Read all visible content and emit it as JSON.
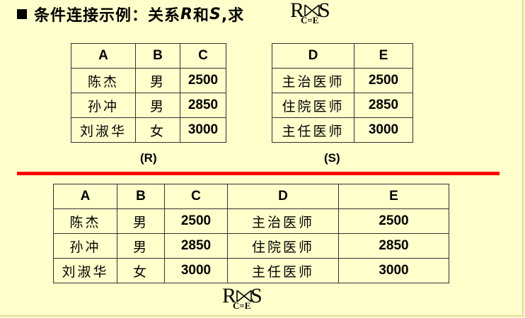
{
  "title": {
    "prefix": "条件连接示例：关系",
    "rel_r": "R",
    "middle": "和",
    "rel_s": "S",
    "suffix": ",求"
  },
  "join_symbol": {
    "left": "R",
    "right": "S",
    "condition": "C=E"
  },
  "table_r": {
    "caption": "(R)",
    "headers": [
      "A",
      "B",
      "C"
    ],
    "rows": [
      [
        "陈杰",
        "男",
        "2500"
      ],
      [
        "孙冲",
        "男",
        "2850"
      ],
      [
        "刘淑华",
        "女",
        "3000"
      ]
    ]
  },
  "table_s": {
    "caption": "(S)",
    "headers": [
      "D",
      "E"
    ],
    "rows": [
      [
        "主治医师",
        "2500"
      ],
      [
        "住院医师",
        "2850"
      ],
      [
        "主任医师",
        "3000"
      ]
    ]
  },
  "table_result": {
    "headers": [
      "A",
      "B",
      "C",
      "D",
      "E"
    ],
    "rows": [
      [
        "陈杰",
        "男",
        "2500",
        "主治医师",
        "2500"
      ],
      [
        "孙冲",
        "男",
        "2850",
        "住院医师",
        "2850"
      ],
      [
        "刘淑华",
        "女",
        "3000",
        "主任医师",
        "3000"
      ]
    ]
  },
  "colors": {
    "background": "#ffffcc",
    "divider": "#ff0000"
  }
}
